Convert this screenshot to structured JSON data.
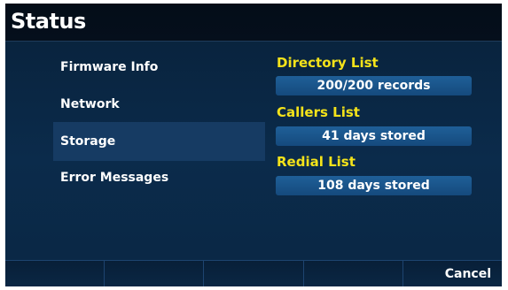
{
  "title": "Status",
  "menu": {
    "items": [
      {
        "label": "Firmware Info"
      },
      {
        "label": "Network"
      },
      {
        "label": "Storage"
      },
      {
        "label": "Error Messages"
      }
    ],
    "selected_index": 2
  },
  "storage": {
    "directory": {
      "title": "Directory List",
      "value": "200/200 records"
    },
    "callers": {
      "title": "Callers List",
      "value": "41 days stored"
    },
    "redial": {
      "title": "Redial List",
      "value": "108 days stored"
    }
  },
  "softkeys": [
    "",
    "",
    "",
    "",
    "Cancel"
  ],
  "colors": {
    "background": "#0b2b4b",
    "titlebar": "#040d18",
    "selection": "#163b63",
    "section_title": "#f4e31a",
    "value_bar": "#1a5690",
    "text": "#ffffff"
  }
}
